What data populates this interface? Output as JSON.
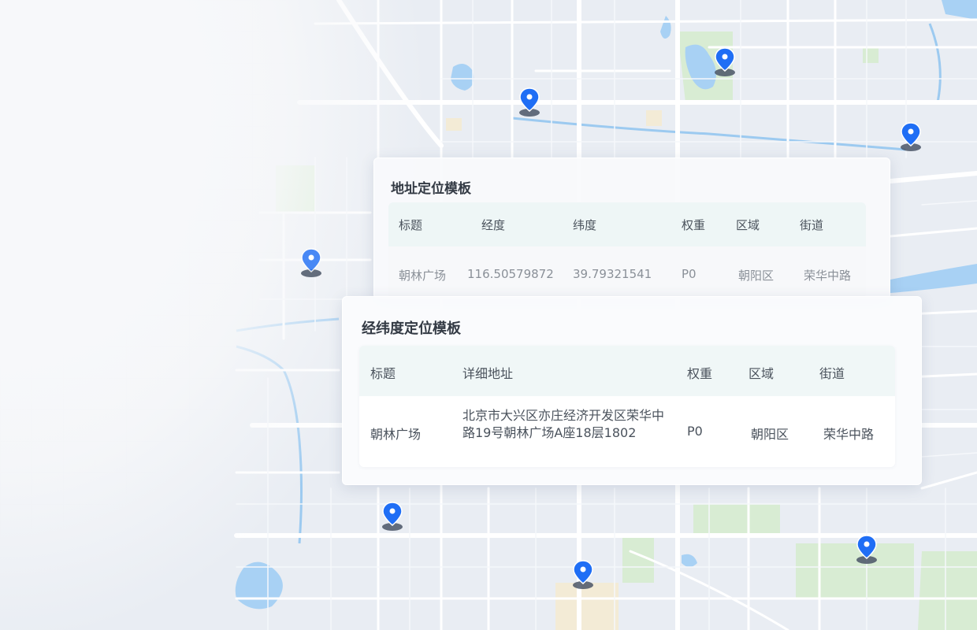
{
  "address_card": {
    "title": "地址定位模板",
    "headers": [
      "标题",
      "经度",
      "纬度",
      "权重",
      "区域",
      "街道"
    ],
    "row": [
      "朝林广场",
      "116.50579872",
      "39.79321541",
      "P0",
      "朝阳区",
      "荣华中路"
    ]
  },
  "coord_card": {
    "title": "经纬度定位模板",
    "headers": [
      "标题",
      "详细地址",
      "权重",
      "区域",
      "街道"
    ],
    "row": [
      "朝林广场",
      "北京市大兴区亦庄经济开发区荣华中路19号朝林广场A座18层1802",
      "P0",
      "朝阳区",
      "荣华中路"
    ]
  },
  "map": {
    "road_color": "#ffffff",
    "water_color": "#a9d4f5",
    "green_color": "#d6ecd0",
    "pin_color": "#1f6ef5",
    "pin_icon": "map-marker-icon"
  }
}
